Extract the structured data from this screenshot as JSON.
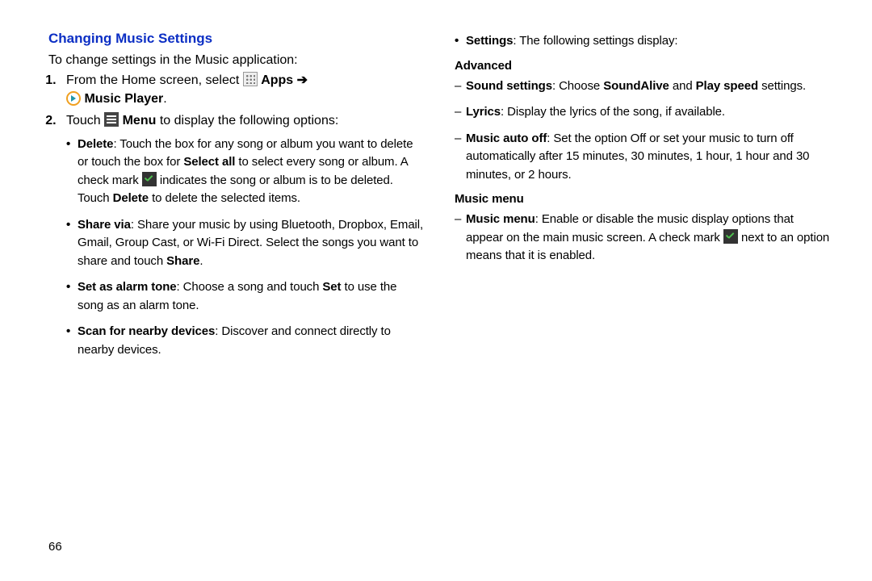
{
  "page_number": "66",
  "left": {
    "title": "Changing Music Settings",
    "intro": "To change settings in the Music application:",
    "step1": {
      "pre": "From the Home screen, select ",
      "apps_label": " Apps ",
      "arrow": "➔",
      "music_label": " Music Player",
      "post": "."
    },
    "step2": {
      "pre": "Touch ",
      "menu_label": " Menu",
      "post": " to display the following options:"
    },
    "opt_delete": {
      "label": "Delete",
      "t1": ": Touch the box for any song or album you want to delete or touch the box for ",
      "b1": "Select all",
      "t2": " to select every song or album. A check mark ",
      "t3": " indicates the song or album is to be deleted. Touch ",
      "b2": "Delete",
      "t4": " to delete the selected items."
    },
    "opt_share": {
      "label": "Share via",
      "t1": ": Share your music by using Bluetooth, Dropbox, Email, Gmail, Group Cast, or Wi-Fi Direct. Select the songs you want to share and touch ",
      "b1": "Share",
      "t2": "."
    },
    "opt_alarm": {
      "label": "Set as alarm tone",
      "t1": ": Choose a song and touch ",
      "b1": "Set",
      "t2": " to use the song as an alarm tone."
    },
    "opt_scan": {
      "label": "Scan for nearby devices",
      "t1": ": Discover and connect directly to nearby devices."
    }
  },
  "right": {
    "settings_label": "Settings",
    "settings_text": ": The following settings display:",
    "advanced_label": "Advanced",
    "sound": {
      "label": "Sound settings",
      "t1": ": Choose ",
      "b1": "SoundAlive",
      "t2": " and ",
      "b2": "Play speed",
      "t3": " settings."
    },
    "lyrics": {
      "label": "Lyrics",
      "t1": ": Display the lyrics of the song, if available."
    },
    "auto_off": {
      "label": "Music auto off",
      "t1": ": Set the option Off or set your music to turn off automatically after 15 minutes, 30 minutes, 1 hour, 1 hour and 30 minutes, or 2 hours."
    },
    "music_menu_label": "Music menu",
    "mm": {
      "label": "Music menu",
      "t1": ": Enable or disable the music display options that appear on the main music screen. A check mark ",
      "t2": " next to an option means that it is enabled."
    }
  }
}
